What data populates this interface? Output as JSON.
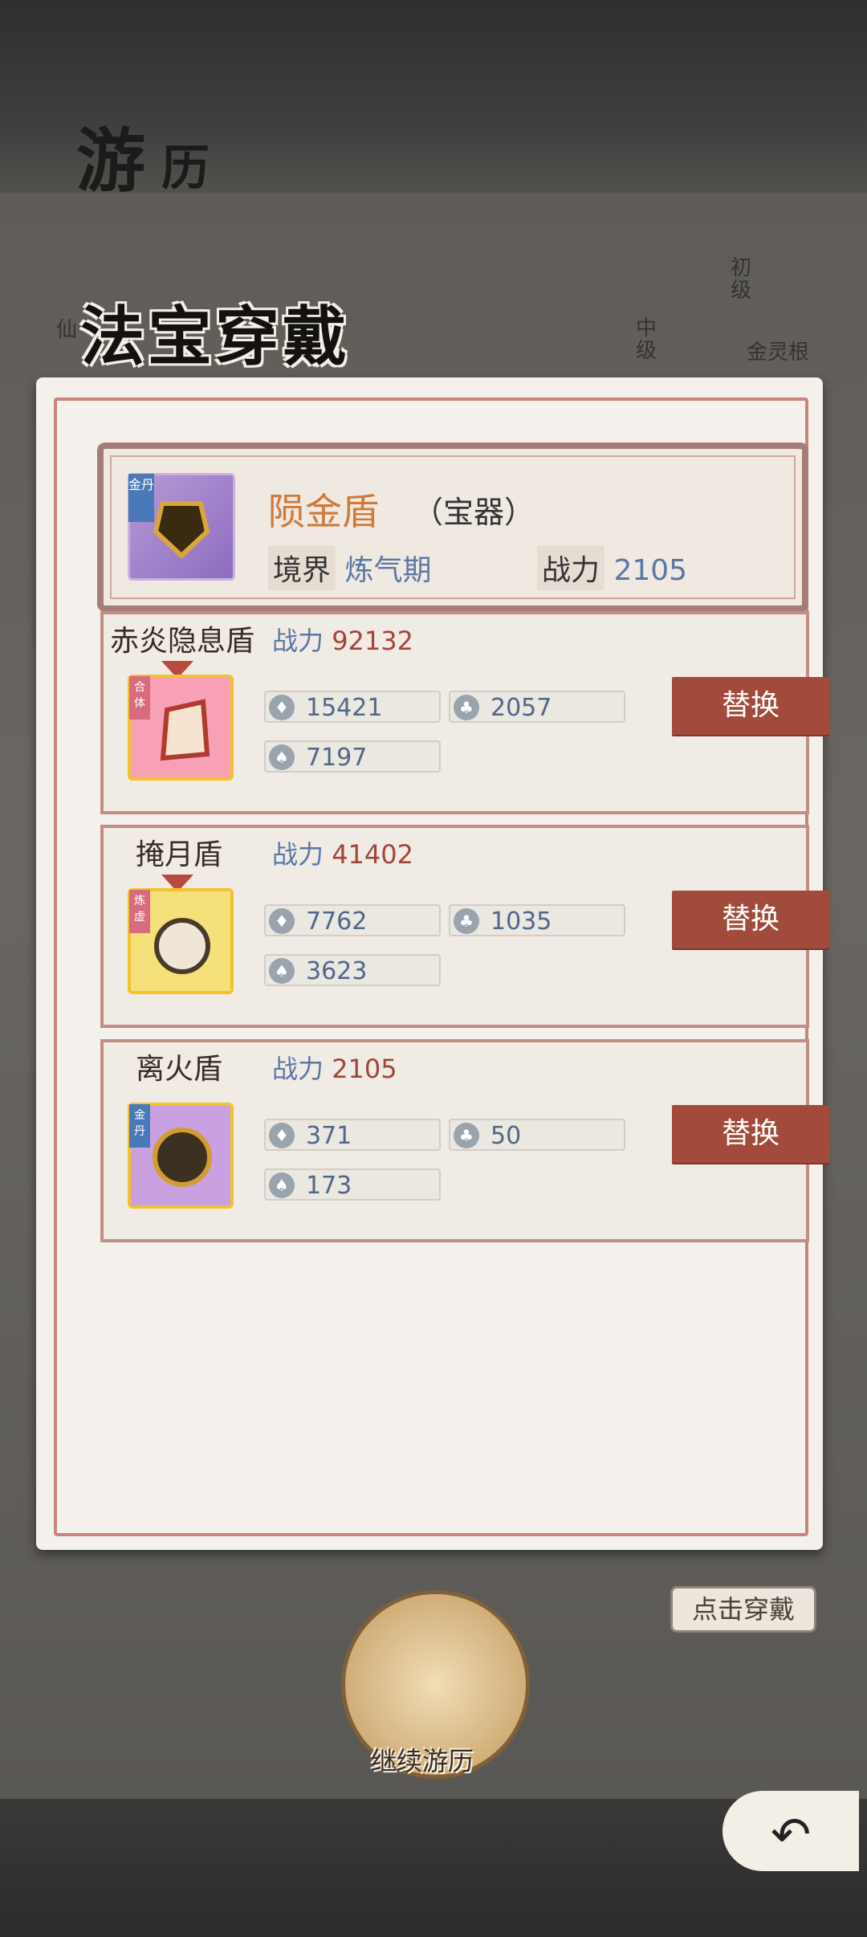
{
  "header": {
    "title_1": "游",
    "title_2": "历"
  },
  "background": {
    "side_left": "仙",
    "rank_1": "初级",
    "rank_2": "中级",
    "golden_root": "金灵根",
    "wear_button": "点击穿戴",
    "continue_label": "继续游历"
  },
  "dialog": {
    "title": "法宝穿戴",
    "current": {
      "name": "陨金盾",
      "type": "（宝器）",
      "tag": "金丹",
      "realm_label": "境界",
      "realm_value": "炼气期",
      "power_label": "战力",
      "power_value": "2105"
    },
    "candidates": [
      {
        "name": "赤炎隐息盾",
        "power_label": "战力",
        "power_value": "92132",
        "tag": "合体",
        "stat_fire": "15421",
        "stat_attack": "2057",
        "stat_defense": "7197",
        "button": "替换",
        "color": "#f7a0b6"
      },
      {
        "name": "掩月盾",
        "power_label": "战力",
        "power_value": "41402",
        "tag": "炼虚",
        "stat_fire": "7762",
        "stat_attack": "1035",
        "stat_defense": "3623",
        "button": "替换",
        "color": "#f5e07a"
      },
      {
        "name": "离火盾",
        "power_label": "战力",
        "power_value": "2105",
        "tag": "金丹",
        "stat_fire": "371",
        "stat_attack": "50",
        "stat_defense": "173",
        "button": "替换",
        "color": "#c9a0e0"
      }
    ]
  },
  "icons": [
    "fire-icon",
    "attack-icon",
    "shield-icon",
    "back-arrow-icon"
  ]
}
